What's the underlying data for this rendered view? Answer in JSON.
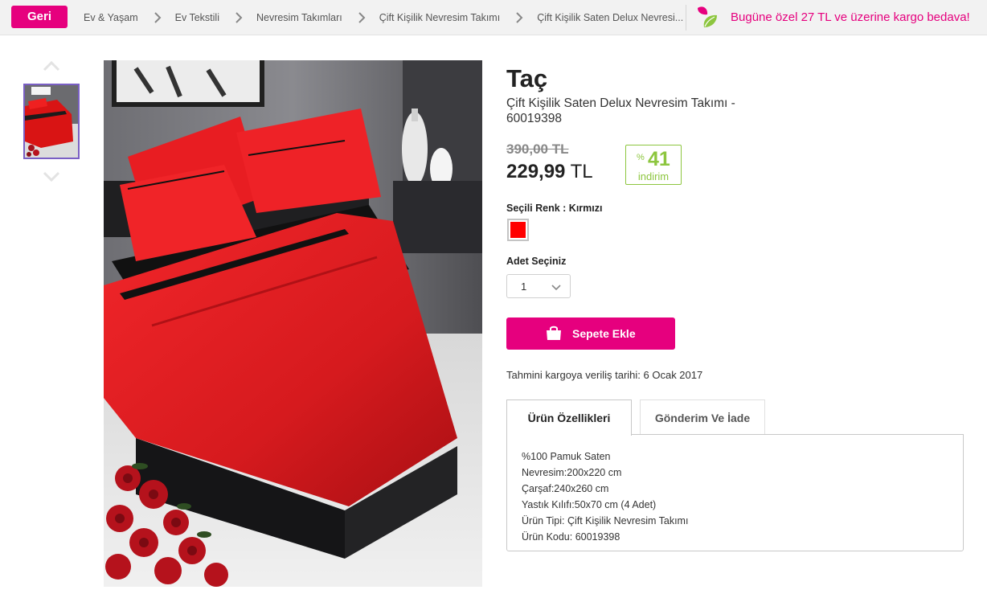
{
  "topbar": {
    "back_label": "Geri",
    "breadcrumbs": [
      "Ev & Yaşam",
      "Ev Tekstili",
      "Nevresim Takımları",
      "Çift Kişilik Nevresim Takımı",
      "Çift Kişilik Saten Delux Nevresi..."
    ],
    "promo_text": "Bugüne özel 27 TL ve üzerine kargo bedava!"
  },
  "product": {
    "brand": "Taç",
    "name": "Çift Kişilik Saten Delux Nevresim Takımı - 60019398",
    "old_price": "390,00 TL",
    "new_price_amount": "229,99",
    "new_price_currency": "TL",
    "discount_symbol": "%",
    "discount_value": "41",
    "discount_label": "indirim",
    "color_label": "Seçili Renk : Kırmızı",
    "color_hex": "#ff0000",
    "qty_label": "Adet Seçiniz",
    "qty_value": "1",
    "cart_button": "Sepete Ekle",
    "ship_date": "Tahmini kargoya veriliş tarihi: 6 Ocak 2017"
  },
  "tabs": {
    "features": "Ürün Özellikleri",
    "shipping": "Gönderim Ve İade"
  },
  "features": [
    "%100 Pamuk Saten",
    "Nevresim:200x220 cm",
    "Çarşaf:240x260 cm",
    "Yastık Kılıfı:50x70 cm (4 Adet)",
    "Ürün Tipi: Çift Kişilik Nevresim Takımı",
    "Ürün Kodu: 60019398"
  ],
  "colors": {
    "brand_pink": "#e6007e",
    "discount_green": "#8dc63f"
  },
  "icons": {
    "back": "back-button",
    "promo": "leaf-icon",
    "thumb_up": "chevron-up-icon",
    "thumb_down": "chevron-down-icon",
    "qty": "chevron-down-icon",
    "cart": "shopping-bag-icon"
  }
}
